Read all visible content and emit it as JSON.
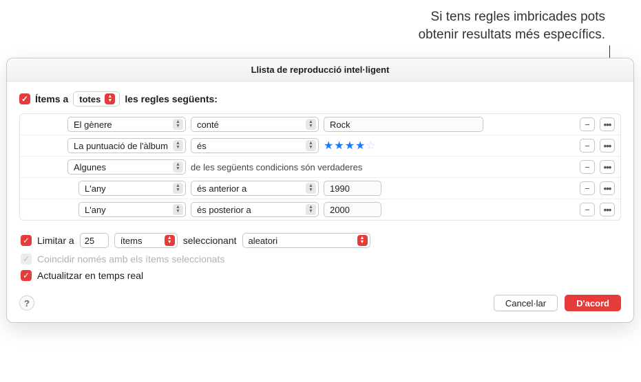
{
  "callout": {
    "line1": "Si tens regles imbricades pots",
    "line2": "obtenir resultats més específics."
  },
  "window": {
    "title": "Llista de reproducció intel·ligent"
  },
  "match": {
    "prefix": "Ítems a",
    "mode": "totes",
    "suffix": "les regles següents:"
  },
  "rules": [
    {
      "indent": 1,
      "field": "El gènere",
      "op": "conté",
      "value": "Rock",
      "type": "text"
    },
    {
      "indent": 1,
      "field": "La puntuació de l'àlbum",
      "op": "és",
      "stars": 4,
      "type": "stars"
    },
    {
      "indent": 1,
      "field": "Algunes",
      "tail": "de les següents condicions són verdaderes",
      "type": "group"
    },
    {
      "indent": 2,
      "field": "L'any",
      "op": "és anterior a",
      "value": "1990",
      "type": "text"
    },
    {
      "indent": 2,
      "field": "L'any",
      "op": "és posterior a",
      "value": "2000",
      "type": "text"
    }
  ],
  "limit": {
    "label": "Limitar a",
    "count": "25",
    "unit": "ítems",
    "selecting": "seleccionant",
    "method": "aleatori"
  },
  "match_checked": {
    "label": "Coincidir només amb els ítems seleccionats"
  },
  "live": {
    "label": "Actualitzar en temps real"
  },
  "buttons": {
    "help": "?",
    "cancel": "Cancel·lar",
    "ok": "D'acord"
  },
  "icons": {
    "check": "✓",
    "minus": "−",
    "dots": "•••",
    "up": "▲",
    "down": "▼",
    "star_on": "★",
    "star_off": "☆"
  }
}
